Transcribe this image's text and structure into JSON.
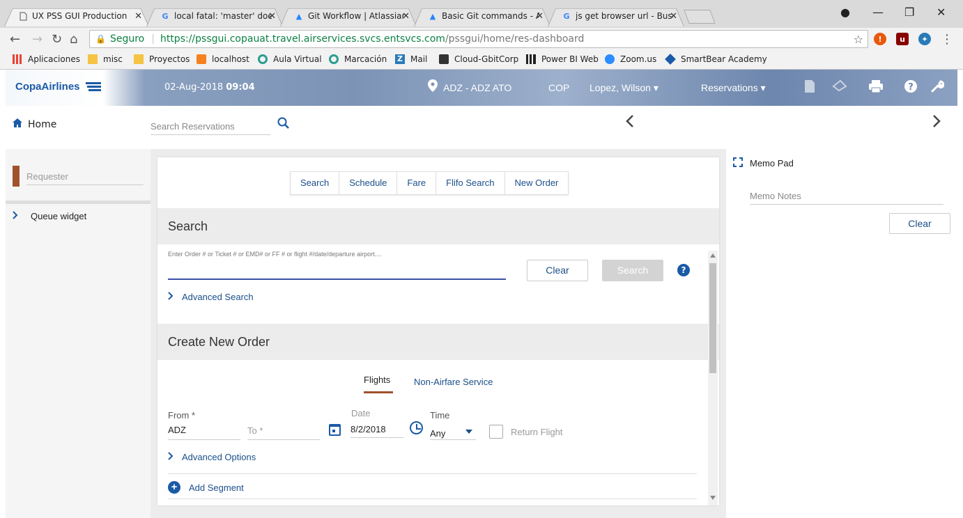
{
  "browser": {
    "tabs": [
      {
        "label": "UX PSS GUI Production",
        "icon": "page-icon"
      },
      {
        "label": "local fatal: 'master' does n",
        "icon": "google-icon"
      },
      {
        "label": "Git Workflow | Atlassian G",
        "icon": "atlassian-icon"
      },
      {
        "label": "Basic Git commands - Atl",
        "icon": "atlassian-icon"
      },
      {
        "label": "js get browser url - Busca",
        "icon": "google-icon"
      }
    ],
    "secure_label": "Seguro",
    "url_host": "https://pssgui.copauat.travel.airservices.svcs.entsvcs.com",
    "url_path": "/pssgui/home/res-dashboard",
    "bookmarks": [
      "Aplicaciones",
      "misc",
      "Proyectos",
      "localhost",
      "Aula Virtual",
      "Marcación",
      "Mail",
      "Cloud-GbitCorp",
      "Power BI Web",
      "Zoom.us",
      "SmartBear Academy"
    ]
  },
  "header": {
    "brand": "CopaAirlines",
    "date": "02-Aug-2018",
    "time": "09:04",
    "location": "ADZ - ADZ ATO",
    "currency": "COP",
    "user": "Lopez, Wilson ▾",
    "menu": "Reservations ▾"
  },
  "subheader": {
    "home_label": "Home",
    "search_placeholder": "Search Reservations"
  },
  "left": {
    "requester_placeholder": "Requester",
    "queue_label": "Queue widget"
  },
  "center": {
    "tabs": [
      "Search",
      "Schedule",
      "Fare",
      "Flifo Search",
      "New Order"
    ],
    "search_title": "Search",
    "search_hint": "Enter Order # or Ticket # or EMD# or FF # or flight #/date/departure airport....",
    "clear_label": "Clear",
    "search_btn_label": "Search",
    "advanced_search": "Advanced Search",
    "create_title": "Create New Order",
    "flights_tab": "Flights",
    "nonair_tab": "Non-Airfare Service",
    "from_label": "From *",
    "from_value": "ADZ",
    "to_label": "To *",
    "date_label": "Date",
    "date_value": "8/2/2018",
    "time_label": "Time",
    "time_value": "Any",
    "return_label": "Return Flight",
    "advanced_options": "Advanced Options",
    "add_segment": "Add Segment"
  },
  "right": {
    "memo_title": "Memo Pad",
    "memo_placeholder": "Memo Notes",
    "clear_label": "Clear"
  },
  "colors": {
    "brand_blue": "#1a5aa6",
    "accent_brown": "#a0522d",
    "link_blue": "#1a4f8a"
  }
}
